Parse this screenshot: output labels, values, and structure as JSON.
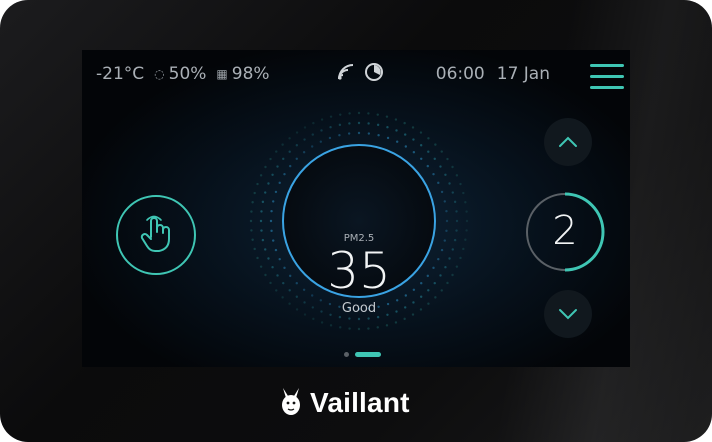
{
  "status": {
    "outdoor_temp": "-21°C",
    "humidity": "50%",
    "filter": "98%",
    "time": "06:00",
    "date": "17 Jan"
  },
  "icons": {
    "humidity": "humidity-drop-icon",
    "filter": "filter-icon",
    "wifi": "wifi-icon",
    "mode": "mode-icon",
    "menu": "menu-icon",
    "hand": "hand-pointer-icon",
    "up": "chevron-up-icon",
    "down": "chevron-down-icon"
  },
  "air_quality": {
    "label": "PM2.5",
    "value": "35",
    "status": "Good"
  },
  "fan_level": {
    "value": "2"
  },
  "pager": {
    "pages": 2,
    "active": 2
  },
  "brand": {
    "name": "Vaillant"
  },
  "colors": {
    "accent": "#3fc6b4",
    "gauge_ring": "#3aa3e3",
    "screen_bg": "#05090e",
    "bezel": "#111112"
  }
}
